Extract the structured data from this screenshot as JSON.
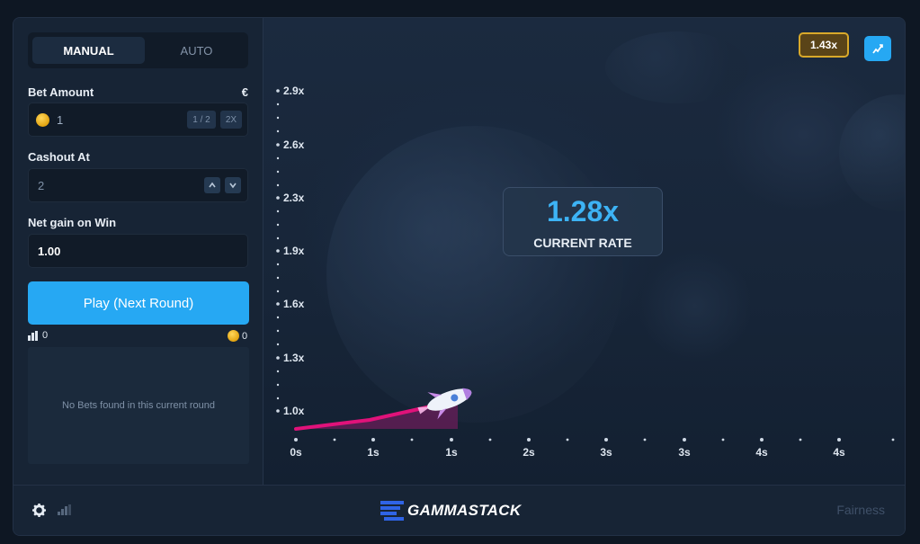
{
  "tabs": {
    "manual": "MANUAL",
    "auto": "AUTO"
  },
  "bet": {
    "label": "Bet Amount",
    "currency": "€",
    "value": "1",
    "half": "1 / 2",
    "double": "2X"
  },
  "cashout": {
    "label": "Cashout At",
    "value": "2"
  },
  "netgain": {
    "label": "Net gain on Win",
    "value": "1.00"
  },
  "play_button": "Play (Next Round)",
  "stats": {
    "players": "0",
    "coins": "0"
  },
  "bets": {
    "empty_text": "No Bets found in this current round"
  },
  "game": {
    "last_rate": "1.43x",
    "current_rate": "1.28x",
    "current_rate_label": "CURRENT RATE",
    "y_ticks": [
      "2.9x",
      "2.6x",
      "2.3x",
      "1.9x",
      "1.6x",
      "1.3x",
      "1.0x"
    ],
    "x_ticks": [
      "0s",
      "1s",
      "1s",
      "2s",
      "3s",
      "3s",
      "4s",
      "4s"
    ]
  },
  "footer": {
    "brand": "GAMMASTACK",
    "fairness": "Fairness"
  },
  "colors": {
    "accent": "#26a8f3",
    "badge_border": "#d9a92a",
    "trail": "#e0127a"
  },
  "icons": {
    "settings": "gear-icon",
    "signal": "signal-icon",
    "chart": "chart-icon",
    "players": "players-icon",
    "coin": "coin-icon",
    "rocket": "rocket-icon"
  }
}
